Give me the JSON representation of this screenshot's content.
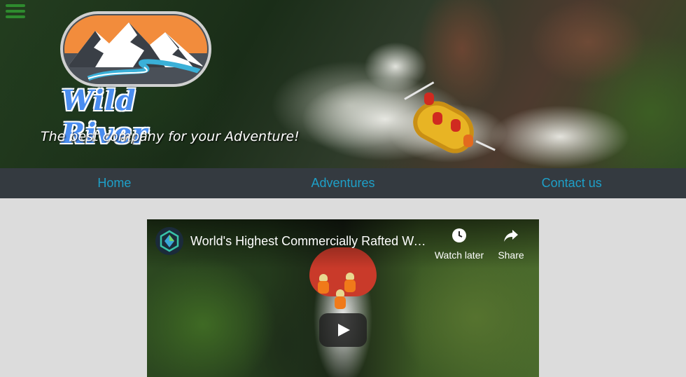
{
  "hero": {
    "brand_name": "Wild River",
    "tagline": "The best company for your Adventure!",
    "menu_icon": "hamburger-icon",
    "logo_icon": "mountain-river-logo-icon"
  },
  "nav": {
    "items": [
      {
        "label": "Home"
      },
      {
        "label": "Adventures"
      },
      {
        "label": "Contact us"
      }
    ]
  },
  "video": {
    "title": "World's Highest Commercially Rafted Wa...",
    "actions": {
      "watch_later": "Watch later",
      "share": "Share"
    },
    "icons": {
      "channel": "channel-avatar-icon",
      "watch_later": "clock-icon",
      "share": "share-arrow-icon",
      "play": "play-icon"
    }
  },
  "colors": {
    "nav_bg": "#343a40",
    "nav_link": "#1ea0c8",
    "page_bg": "#dcdcdc",
    "brand_blue": "#4a8df0",
    "logo_orange": "#f28c3c"
  }
}
